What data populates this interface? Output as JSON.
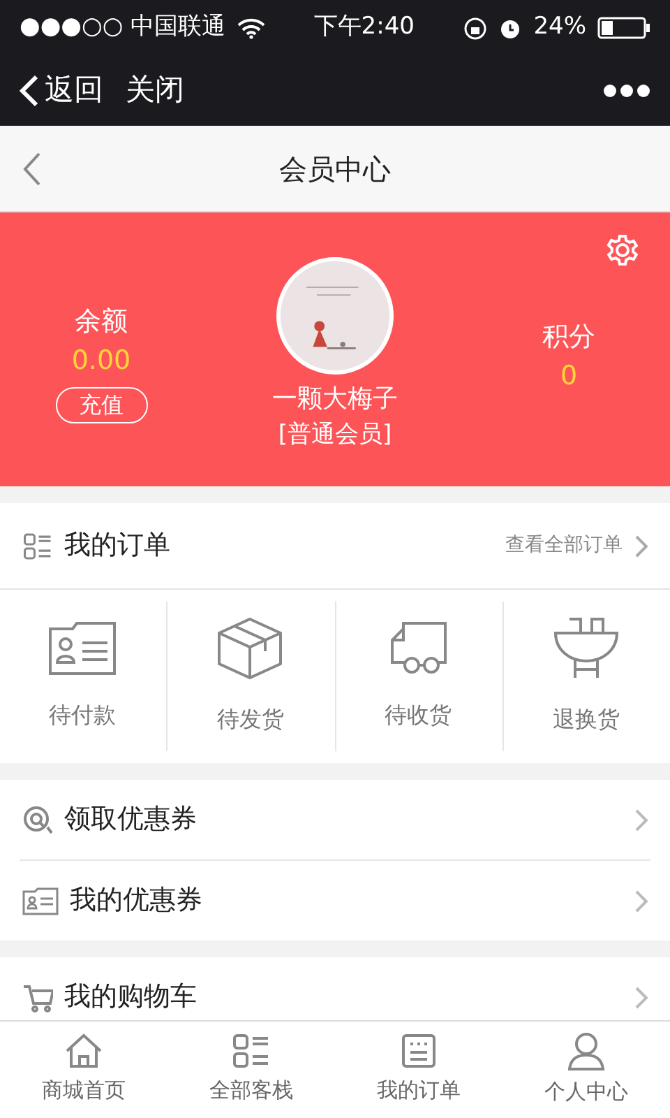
{
  "status_bar": {
    "carrier": "●●●○○ 中国联通",
    "time": "下午2:40",
    "battery": "24%"
  },
  "wechat_bar": {
    "back": "返回",
    "close": "关闭"
  },
  "header": {
    "title": "会员中心"
  },
  "member": {
    "balance_label": "余额",
    "balance": "0.00",
    "recharge": "充值",
    "name": "一颗大梅子",
    "level": "[普通会员]",
    "points_label": "积分",
    "points": "0"
  },
  "orders": {
    "title": "我的订单",
    "view_all": "查看全部订单",
    "statuses": [
      {
        "kind": "pay",
        "label": "待付款"
      },
      {
        "kind": "ship",
        "label": "待发货"
      },
      {
        "kind": "receive",
        "label": "待收货"
      },
      {
        "kind": "return",
        "label": "退换货"
      }
    ]
  },
  "menu_groups": [
    [
      {
        "kind": "get-coupon",
        "label": "领取优惠券"
      },
      {
        "kind": "my-coupon",
        "label": "我的优惠券"
      }
    ],
    [
      {
        "kind": "cart",
        "label": "我的购物车"
      }
    ]
  ],
  "tab_bar": [
    {
      "kind": "home",
      "label": "商城首页"
    },
    {
      "kind": "list",
      "label": "全部客栈"
    },
    {
      "kind": "orders",
      "label": "我的订单"
    },
    {
      "kind": "user",
      "label": "个人中心"
    }
  ]
}
